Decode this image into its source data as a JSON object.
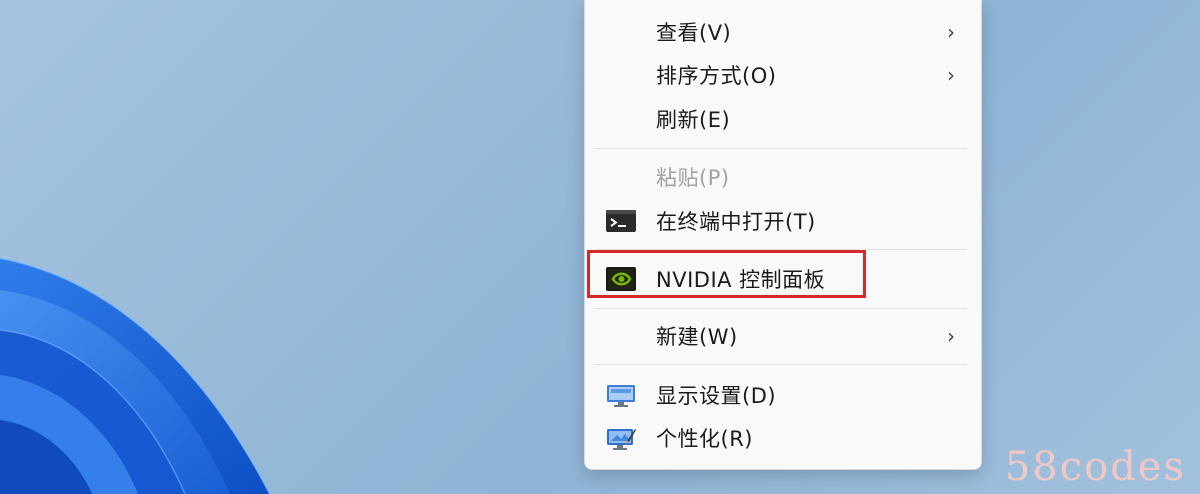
{
  "context_menu": {
    "items": [
      {
        "label": "查看(V)",
        "has_submenu": true,
        "disabled": false,
        "icon": null
      },
      {
        "label": "排序方式(O)",
        "has_submenu": true,
        "disabled": false,
        "icon": null
      },
      {
        "label": "刷新(E)",
        "has_submenu": false,
        "disabled": false,
        "icon": null
      },
      {
        "label": "粘贴(P)",
        "has_submenu": false,
        "disabled": true,
        "icon": null
      },
      {
        "label": "在终端中打开(T)",
        "has_submenu": false,
        "disabled": false,
        "icon": "terminal-icon"
      },
      {
        "label": "NVIDIA 控制面板",
        "has_submenu": false,
        "disabled": false,
        "icon": "nvidia-icon",
        "highlighted": true
      },
      {
        "label": "新建(W)",
        "has_submenu": true,
        "disabled": false,
        "icon": null
      },
      {
        "label": "显示设置(D)",
        "has_submenu": false,
        "disabled": false,
        "icon": "display-settings-icon"
      },
      {
        "label": "个性化(R)",
        "has_submenu": false,
        "disabled": false,
        "icon": "personalize-icon"
      }
    ],
    "chevron": "›"
  },
  "watermark": "58codes",
  "colors": {
    "highlight_border": "#d42a2a",
    "menu_background": "#f9f9f9",
    "disabled_text": "#a3a3a3",
    "watermark": "#f1c9c4",
    "nvidia_green": "#76b900"
  }
}
